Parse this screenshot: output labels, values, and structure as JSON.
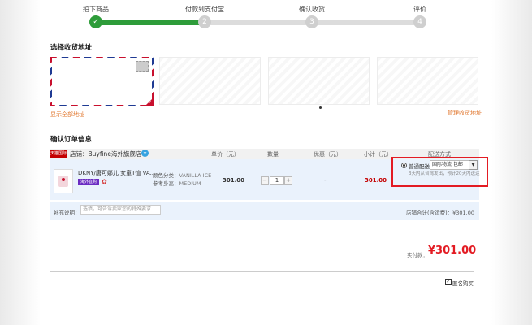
{
  "steps": [
    {
      "label": "拍下商品",
      "number": "✓",
      "done": true
    },
    {
      "label": "付款到支付宝",
      "number": "2",
      "done": false
    },
    {
      "label": "确认收货",
      "number": "3",
      "done": false
    },
    {
      "label": "评价",
      "number": "4",
      "done": false
    }
  ],
  "address_section": {
    "title": "选择收货地址",
    "show_all_link": "显示全部地址",
    "manage_link": "管理收货地址"
  },
  "order_section": {
    "title": "确认订单信息",
    "shop_badge": "天猫国际",
    "shop_label": "店铺：Buyfine海外旗舰店",
    "columns": {
      "price": "单价（元）",
      "qty": "数量",
      "discount": "优惠（元）",
      "subtotal": "小计（元）",
      "shipping": "配送方式"
    },
    "item": {
      "title": "DKNY/唐可娜儿 女童T恤 VA...",
      "badge": "海外直购",
      "attr_color_label": "颜色分类：",
      "attr_color_value": "VANILLA ICE",
      "attr_size_label": "参考身高：",
      "attr_size_value": "MEDIUM",
      "price": "301.00",
      "qty": "1",
      "discount": "-",
      "subtotal": "301.00"
    },
    "shipping": {
      "label": "普通配送",
      "selected": "国际物流 包邮",
      "note": "3天内从台湾发出，预计20天内送达"
    },
    "message_label": "补充说明：",
    "message_placeholder": "选填，可告诉卖家您的特殊要求",
    "shop_total": "店铺合计(含运费)：¥301.00"
  },
  "payment": {
    "label": "实付款：",
    "amount": "¥301.00",
    "anonymous_label": "匿名购买"
  },
  "colors": {
    "accent_red": "#e31b23",
    "step_green": "#2e9c3a",
    "link_orange": "#e0742a"
  }
}
